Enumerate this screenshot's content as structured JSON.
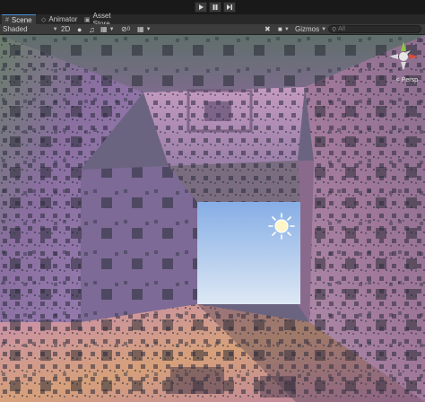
{
  "playbar": {
    "play_icon": "play-icon",
    "pause_icon": "pause-icon",
    "step_icon": "step-icon"
  },
  "tabs": [
    {
      "label": "Scene",
      "icon": "scene-icon",
      "active": true
    },
    {
      "label": "Animator",
      "icon": "animator-icon",
      "active": false
    },
    {
      "label": "Asset Store",
      "icon": "asset-store-icon",
      "active": false
    }
  ],
  "toolbar": {
    "draw_mode": "Shaded",
    "mode_2d": "2D",
    "gizmos_label": "Gizmos",
    "search_placeholder": "All"
  },
  "viewport": {
    "projection_label": "< Persp",
    "sky_color": "#9fc0e8",
    "accent": "#4a90d9"
  }
}
